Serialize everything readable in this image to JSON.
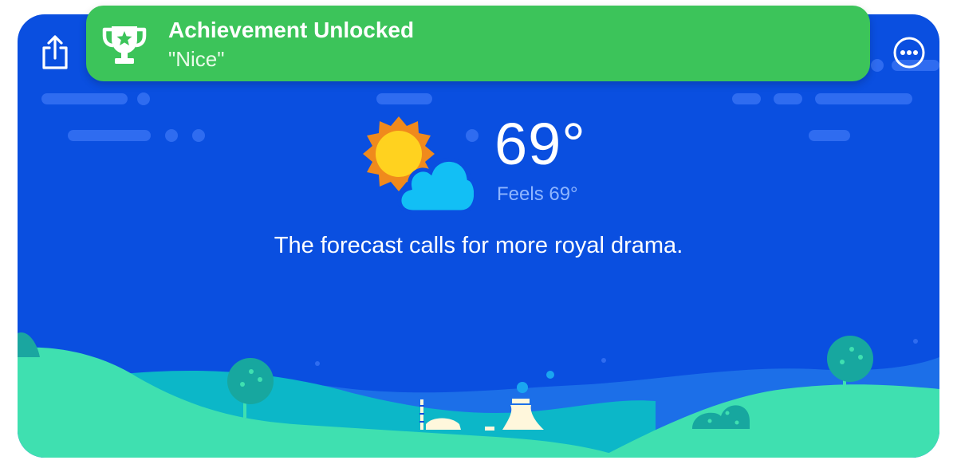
{
  "weather": {
    "temperature": "69°",
    "feels_like": "Feels 69°",
    "forecast_text": "The forecast calls for more royal drama.",
    "condition_icon": "partly-cloudy-icon"
  },
  "toast": {
    "title": "Achievement Unlocked",
    "subtitle": "\"Nice\"",
    "icon": "trophy-icon",
    "color": "#3cc45a"
  },
  "toolbar": {
    "share_icon": "share-icon",
    "more_icon": "more-options-icon"
  },
  "colors": {
    "sky": "#0a4fe0",
    "hills": "#3fe0b0",
    "sun": "#ffd21f",
    "sun_rays": "#f08a1c",
    "cloud": "#12bff5"
  }
}
